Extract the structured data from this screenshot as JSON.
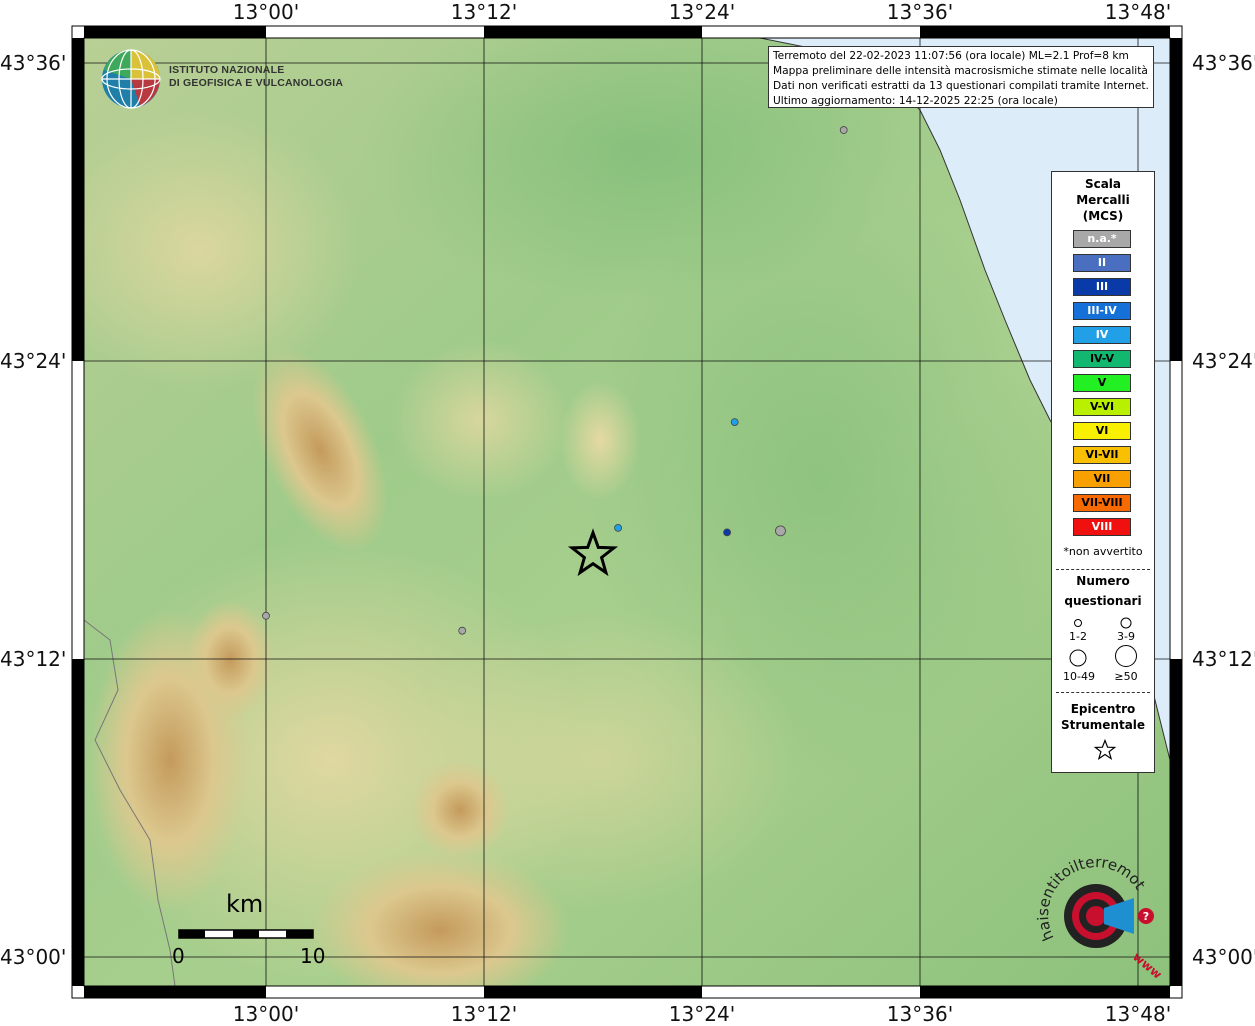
{
  "header": {
    "institute_line1": "ISTITUTO NAZIONALE",
    "institute_line2": "DI GEOFISICA E VULCANOLOGIA"
  },
  "info": {
    "line1": "Terremoto del 22-02-2023 11:07:56 (ora locale) ML=2.1 Prof=8 km",
    "line2": "Mappa preliminare delle intensità macrosismiche stimate nelle località",
    "line3": "Dati non verificati estratti da 13 questionari compilati tramite Internet.",
    "line4": "Ultimo aggiornamento: 14-12-2025 22:25 (ora locale)"
  },
  "axes": {
    "lon_labels": [
      "13°00'",
      "13°12'",
      "13°24'",
      "13°36'",
      "13°48'"
    ],
    "lat_labels": [
      "43°36'",
      "43°24'",
      "43°12'",
      "43°00'"
    ]
  },
  "legend": {
    "title_lines": [
      "Scala",
      "Mercalli",
      "(MCS)"
    ],
    "scale": [
      {
        "label": "n.a.*",
        "color": "#a8a8a8",
        "text_color": "#ffffff"
      },
      {
        "label": "II",
        "color": "#4a6fc0",
        "text_color": "#ffffff"
      },
      {
        "label": "III",
        "color": "#0a3aa8",
        "text_color": "#ffffff"
      },
      {
        "label": "III-IV",
        "color": "#1570d8",
        "text_color": "#ffffff"
      },
      {
        "label": "IV",
        "color": "#21a0e8",
        "text_color": "#ffffff"
      },
      {
        "label": "IV-V",
        "color": "#12b870",
        "text_color": "#000000"
      },
      {
        "label": "V",
        "color": "#22f022",
        "text_color": "#000000"
      },
      {
        "label": "V-VI",
        "color": "#b8f000",
        "text_color": "#000000"
      },
      {
        "label": "VI",
        "color": "#f8f000",
        "text_color": "#000000"
      },
      {
        "label": "VI-VII",
        "color": "#f8c000",
        "text_color": "#000000"
      },
      {
        "label": "VII",
        "color": "#f8a000",
        "text_color": "#000000"
      },
      {
        "label": "VII-VIII",
        "color": "#f86a00",
        "text_color": "#000000"
      },
      {
        "label": "VIII",
        "color": "#f01010",
        "text_color": "#ffffff"
      }
    ],
    "not_felt_note": "*non avvertito",
    "questionnaire_title_1": "Numero",
    "questionnaire_title_2": "questionari",
    "q_sizes": [
      "1-2",
      "3-9",
      "10-49",
      "≥50"
    ],
    "epicenter_title_1": "Epicentro",
    "epicenter_title_2": "Strumentale"
  },
  "scalebar": {
    "unit": "km",
    "start": "0",
    "end": "10"
  },
  "observations": [
    {
      "lon": 13.53,
      "lat": 43.555,
      "intensity": "n.a.*",
      "count": "1-2"
    },
    {
      "lon": 13.43,
      "lat": 43.359,
      "intensity": "IV",
      "count": "1-2"
    },
    {
      "lon": 13.323,
      "lat": 43.288,
      "intensity": "IV",
      "count": "1-2"
    },
    {
      "lon": 13.423,
      "lat": 43.285,
      "intensity": "III",
      "count": "1-2"
    },
    {
      "lon": 13.472,
      "lat": 43.286,
      "intensity": "n.a.*",
      "count": "3-9"
    },
    {
      "lon": 13.0,
      "lat": 43.229,
      "intensity": "n.a.*",
      "count": "1-2"
    },
    {
      "lon": 13.18,
      "lat": 43.219,
      "intensity": "n.a.*",
      "count": "1-2"
    }
  ],
  "epicenter": {
    "lon": 13.3,
    "lat": 43.27
  },
  "site_logo_text": "haisentitoilterremoto.it",
  "site_logo_url_text": "www."
}
